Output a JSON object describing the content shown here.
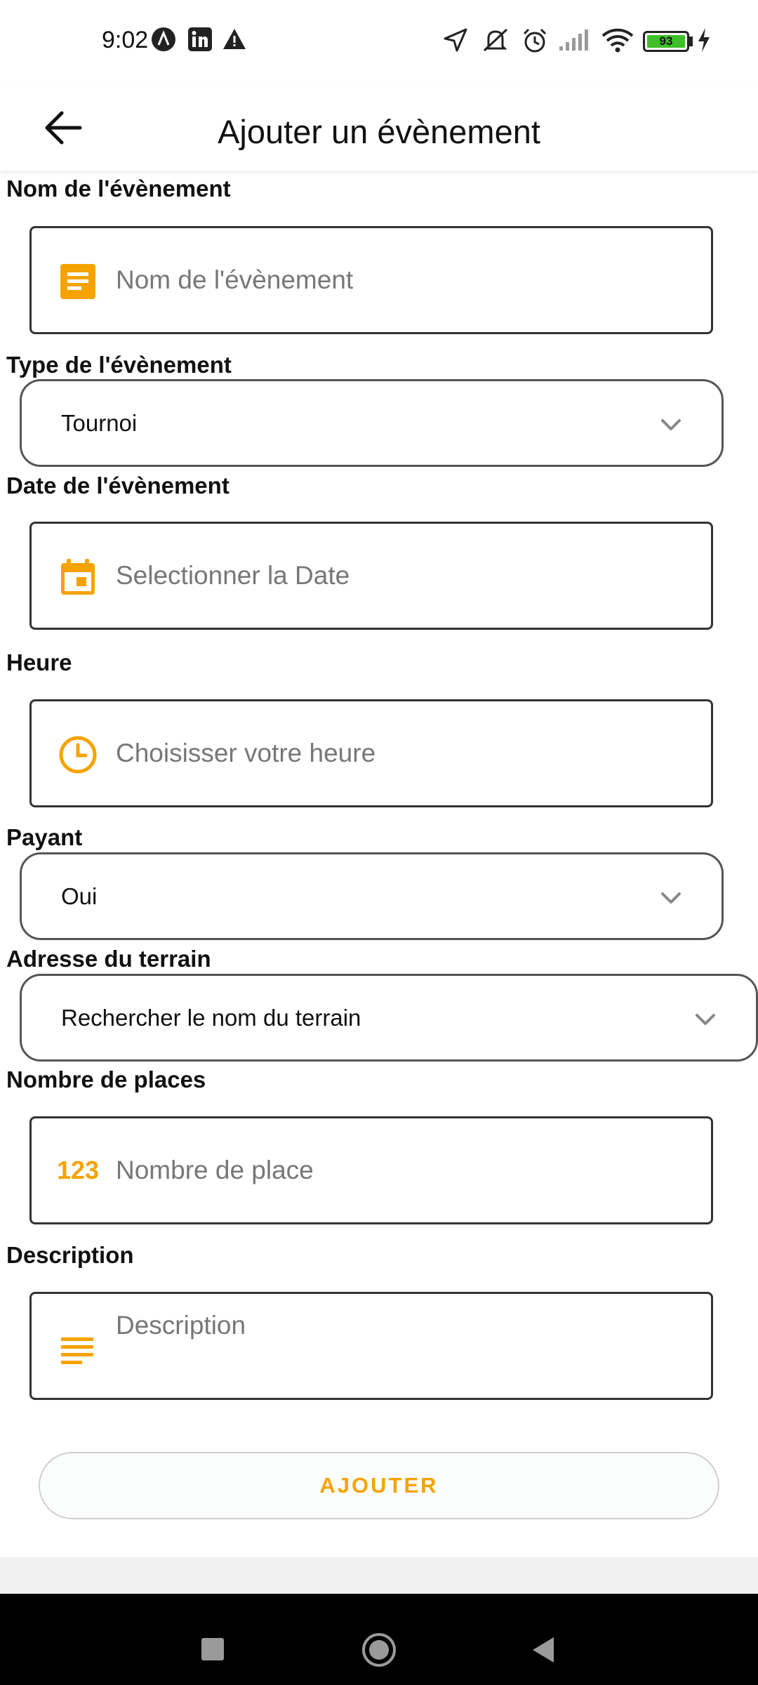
{
  "status_bar": {
    "time": "9:02",
    "battery": "93"
  },
  "header": {
    "title": "Ajouter un évènement"
  },
  "form": {
    "name": {
      "label": "Nom de l'évènement",
      "placeholder": "Nom de l'évènement",
      "icon": "document-icon"
    },
    "type": {
      "label": "Type de l'évènement",
      "value": "Tournoi"
    },
    "date": {
      "label": "Date de l'évènement",
      "placeholder": "Selectionner la Date",
      "icon": "calendar-icon"
    },
    "time": {
      "label": "Heure",
      "placeholder": "Choisisser votre heure",
      "icon": "clock-icon"
    },
    "paid": {
      "label": "Payant",
      "value": "Oui"
    },
    "address": {
      "label": "Adresse du terrain",
      "value": "Rechercher le nom du terrain"
    },
    "places": {
      "label": "Nombre de places",
      "placeholder": "Nombre de place",
      "icon_text": "123"
    },
    "description": {
      "label": "Description",
      "placeholder": "Description",
      "icon": "notes-icon"
    },
    "submit_label": "AJOUTER"
  },
  "colors": {
    "accent": "#F5A300",
    "border": "#333333"
  }
}
